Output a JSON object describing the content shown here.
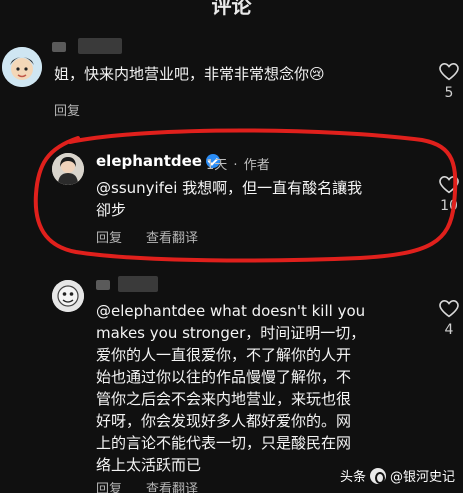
{
  "header": {
    "title": "评论"
  },
  "comments": [
    {
      "username_blurred": true,
      "text": "姐，快来内地营业吧，非常非常想念你😢",
      "reply_label": "回复",
      "likes": "5"
    },
    {
      "username": "elephantdee",
      "verified": true,
      "time": "1天",
      "author_tag": "作者",
      "meta_sep": "·",
      "text_line1": "@ssunyifei 我想啊，但一直有酸名讓我",
      "text_line2": "卻步",
      "reply_label": "回复",
      "translate_label": "查看翻译",
      "likes": "10"
    },
    {
      "username_blurred": true,
      "text_lines": [
        "@elephantdee what doesn't kill you",
        "makes you stronger，时间证明一切，",
        "爱你的人一直很爱你，不了解你的人开",
        "始也通过你以往的作品慢慢了解你，不",
        "管你之后会不会来内地营业，来玩也很",
        "好呀，你会发现好多人都好爱你的。网",
        "上的言论不能代表一切，只是酸民在网",
        "络上太活跃而已"
      ],
      "reply_label": "回复",
      "translate_label": "查看翻译",
      "likes": "4"
    }
  ],
  "colors": {
    "highlight_ring": "#e0201c",
    "verified": "#2a8cf5",
    "background": "#101010"
  },
  "watermark": {
    "platform": "头条",
    "account": "@银河史记"
  }
}
